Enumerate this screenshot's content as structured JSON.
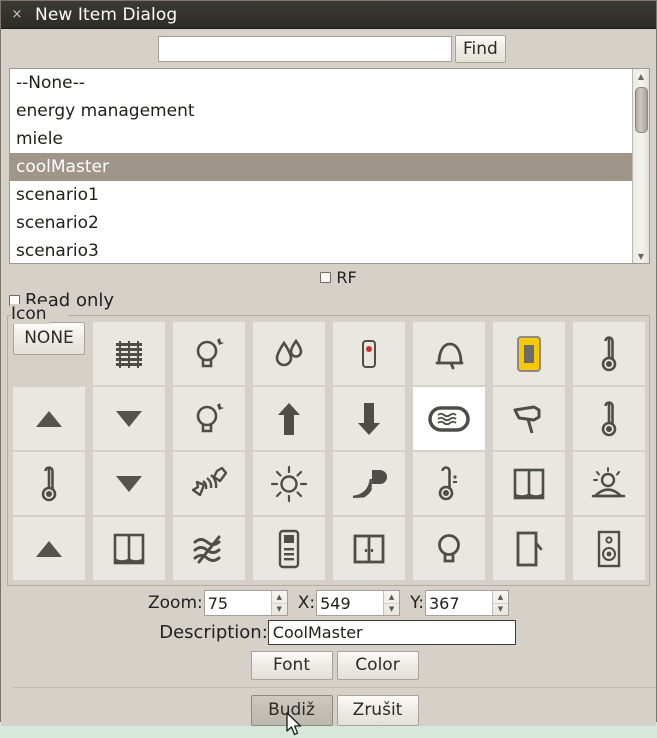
{
  "window": {
    "title": "New Item Dialog",
    "close_icon": "close-icon"
  },
  "search": {
    "value": "",
    "placeholder": "",
    "find_label": "Find"
  },
  "list": {
    "items": [
      {
        "label": "--None--",
        "selected": false
      },
      {
        "label": "energy management",
        "selected": false
      },
      {
        "label": "miele",
        "selected": false
      },
      {
        "label": "coolMaster",
        "selected": true
      },
      {
        "label": "scenario1",
        "selected": false
      },
      {
        "label": "scenario2",
        "selected": false
      },
      {
        "label": "scenario3",
        "selected": false
      }
    ],
    "scrollbar": {
      "up_icon": "triangle-up-icon",
      "down_icon": "triangle-down-icon"
    }
  },
  "options": {
    "rf_label": "RF",
    "rf_checked": false,
    "read_only_label": "Read only",
    "read_only_checked": false
  },
  "icon_group": {
    "title": "Icon",
    "none_label": "NONE",
    "cells": [
      {
        "name": "blinds-icon",
        "selected": false
      },
      {
        "name": "lightbulb-on-icon",
        "selected": false
      },
      {
        "name": "water-drops-icon",
        "selected": false
      },
      {
        "name": "sensor-icon",
        "selected": false
      },
      {
        "name": "bell-icon",
        "selected": false
      },
      {
        "name": "yellow-device-icon",
        "selected": false
      },
      {
        "name": "thermometer-icon",
        "selected": false
      },
      {
        "name": "arrow-up-triangle-icon",
        "selected": false
      },
      {
        "name": "arrow-down-triangle-icon",
        "selected": false
      },
      {
        "name": "lightbulb-on-icon",
        "selected": false
      },
      {
        "name": "arrow-up-icon",
        "selected": false
      },
      {
        "name": "arrow-down-icon",
        "selected": false
      },
      {
        "name": "air-conditioner-icon",
        "selected": true
      },
      {
        "name": "hairdryer-icon",
        "selected": false
      },
      {
        "name": "thermometer-icon",
        "selected": false
      },
      {
        "name": "thermometer-icon",
        "selected": false
      },
      {
        "name": "arrow-down-triangle-icon",
        "selected": false
      },
      {
        "name": "speakers-icon",
        "selected": false
      },
      {
        "name": "sun-icon",
        "selected": false
      },
      {
        "name": "speaker-waves-icon",
        "selected": false
      },
      {
        "name": "thermometer-small-icon",
        "selected": false
      },
      {
        "name": "shutter-icon",
        "selected": false
      },
      {
        "name": "sun-awning-icon",
        "selected": false
      },
      {
        "name": "arrow-up-triangle-icon",
        "selected": false
      },
      {
        "name": "shutter-icon",
        "selected": false
      },
      {
        "name": "wave-lines-icon",
        "selected": false
      },
      {
        "name": "remote-control-icon",
        "selected": false
      },
      {
        "name": "window-icon",
        "selected": false
      },
      {
        "name": "lightbulb-icon",
        "selected": false
      },
      {
        "name": "door-icon",
        "selected": false
      },
      {
        "name": "speaker-box-icon",
        "selected": false
      }
    ]
  },
  "fields": {
    "zoom_label": "Zoom:",
    "zoom_value": "75",
    "x_label": "X:",
    "x_value": "549",
    "y_label": "Y:",
    "y_value": "367",
    "description_label": "Description:",
    "description_value": "CoolMaster",
    "font_label": "Font",
    "color_label": "Color"
  },
  "footer": {
    "ok_label": "Budiž",
    "cancel_label": "Zrušit"
  },
  "colors": {
    "accent_yellow": "#f5c800",
    "selection": "#a09589",
    "dialog_bg": "#d6d1c8",
    "titlebar": "#322f2b"
  }
}
